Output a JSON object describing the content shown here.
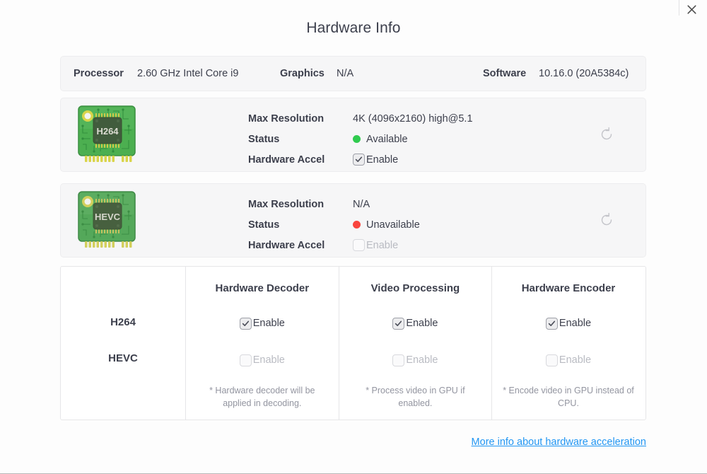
{
  "window": {
    "close_icon": "close-icon"
  },
  "page_title": "Hardware Info",
  "summary": {
    "processor_label": "Processor",
    "processor_value": "2.60 GHz Intel Core i9",
    "graphics_label": "Graphics",
    "graphics_value": "N/A",
    "software_label": "Software",
    "software_value": "10.16.0 (20A5384c)"
  },
  "codecs": [
    {
      "chip_name": "H264",
      "max_resolution_label": "Max Resolution",
      "max_resolution_value": "4K (4096x2160) high@5.1",
      "status_label": "Status",
      "status_value": "Available",
      "status_color": "#30cb4f",
      "hw_accel_label": "Hardware Accel",
      "hw_accel_checkbox_label": "Enable",
      "hw_accel_checked": true,
      "hw_accel_disabled": false,
      "refresh_icon": "refresh-icon"
    },
    {
      "chip_name": "HEVC",
      "max_resolution_label": "Max Resolution",
      "max_resolution_value": "N/A",
      "status_label": "Status",
      "status_value": "Unavailable",
      "status_color": "#f9453e",
      "hw_accel_label": "Hardware Accel",
      "hw_accel_checkbox_label": "Enable",
      "hw_accel_checked": false,
      "hw_accel_disabled": true,
      "refresh_icon": "refresh-icon"
    }
  ],
  "matrix": {
    "row_labels": [
      "H264",
      "HEVC"
    ],
    "columns": [
      {
        "header": "Hardware Decoder",
        "h264_label": "Enable",
        "h264_checked": true,
        "hevc_label": "Enable",
        "hevc_checked": false,
        "note": "* Hardware decoder will be applied in decoding."
      },
      {
        "header": "Video Processing",
        "h264_label": "Enable",
        "h264_checked": true,
        "hevc_label": "Enable",
        "hevc_checked": false,
        "note": "* Process video in GPU if enabled."
      },
      {
        "header": "Hardware Encoder",
        "h264_label": "Enable",
        "h264_checked": true,
        "hevc_label": "Enable",
        "hevc_checked": false,
        "note": "* Encode video in GPU instead of CPU."
      }
    ]
  },
  "footer": {
    "more_info_link": "More info about hardware acceleration",
    "link_color": "#2196f3"
  }
}
